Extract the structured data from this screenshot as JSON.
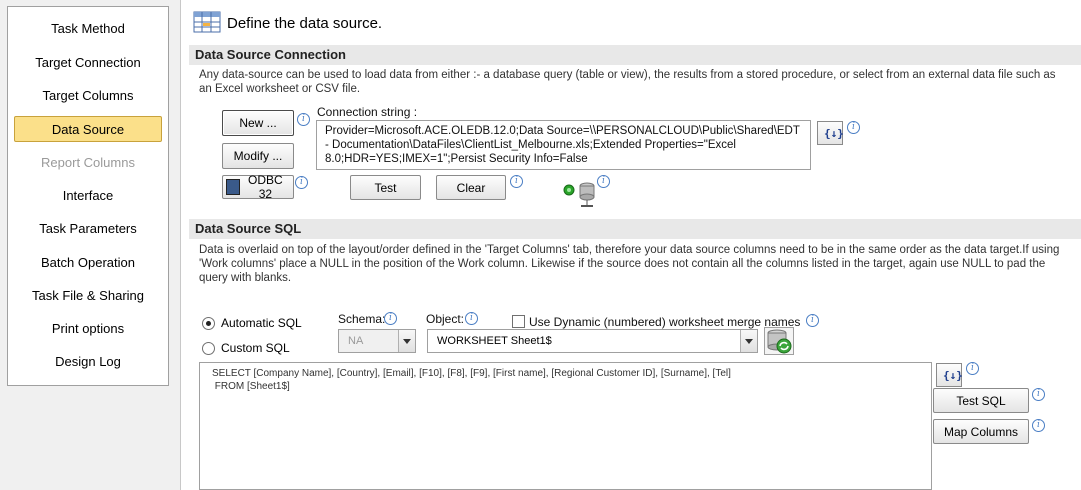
{
  "sidebar": {
    "items": [
      {
        "label": "Task Method",
        "state": "normal"
      },
      {
        "label": "Target Connection",
        "state": "normal"
      },
      {
        "label": "Target Columns",
        "state": "normal"
      },
      {
        "label": "Data Source",
        "state": "active"
      },
      {
        "label": "Report Columns",
        "state": "disabled"
      },
      {
        "label": "Interface",
        "state": "normal"
      },
      {
        "label": "Task Parameters",
        "state": "normal"
      },
      {
        "label": "Batch Operation",
        "state": "normal"
      },
      {
        "label": "Task File & Sharing",
        "state": "normal"
      },
      {
        "label": "Print options",
        "state": "normal"
      },
      {
        "label": "Design Log",
        "state": "normal"
      }
    ]
  },
  "header": {
    "title": "Define the data source."
  },
  "connection": {
    "section_title": "Data Source Connection",
    "description": "Any data-source can be used to load data from either :- a database query (table or view), the results from a stored procedure, or select from an external data file such as an Excel worksheet or CSV file.",
    "new_label": "New ...",
    "modify_label": "Modify ...",
    "odbc_label": "ODBC 32",
    "conn_string_label": "Connection string :",
    "conn_string_value": "Provider=Microsoft.ACE.OLEDB.12.0;Data Source=\\\\PERSONALCLOUD\\Public\\Shared\\EDT - Documentation\\DataFiles\\ClientList_Melbourne.xls;Extended Properties=\"Excel 8.0;HDR=YES;IMEX=1\";Persist Security Info=False",
    "test_label": "Test",
    "clear_label": "Clear",
    "var_button_label": "{↓}"
  },
  "sql": {
    "section_title": "Data Source SQL",
    "description": "Data is overlaid on top of the layout/order defined in the 'Target Columns' tab,  therefore your data source columns need to be in the same order as the data target.If using 'Work columns' place a NULL in the position of the Work column.  Likewise if the source does not contain all the columns listed in the target, again use NULL to pad the query with blanks.",
    "automatic_label": "Automatic SQL",
    "custom_label": "Custom SQL",
    "schema_label": "Schema:",
    "schema_value": "NA",
    "object_label": "Object:",
    "object_value": "WORKSHEET Sheet1$",
    "dynamic_label": "Use Dynamic (numbered) worksheet merge names",
    "query_text": "SELECT [Company Name], [Country], [Email], [F10], [F8], [F9], [First name], [Regional Customer ID], [Surname], [Tel]\n FROM [Sheet1$]",
    "test_sql_label": "Test SQL",
    "map_columns_label": "Map Columns",
    "var_button_label": "{↓}"
  },
  "colors": {
    "active_tab": "#fbe08a",
    "info_blue": "#4a7ec4",
    "status_green": "#2aa52a"
  }
}
